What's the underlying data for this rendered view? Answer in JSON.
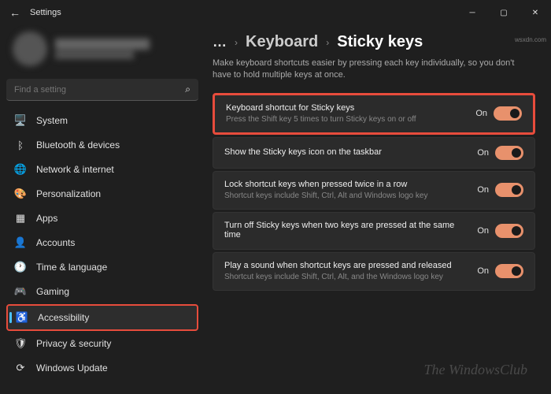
{
  "window": {
    "title": "Settings"
  },
  "search": {
    "placeholder": "Find a setting"
  },
  "sidebar": {
    "items": [
      {
        "label": "System",
        "icon": "🖥️"
      },
      {
        "label": "Bluetooth & devices",
        "icon": "ᛒ"
      },
      {
        "label": "Network & internet",
        "icon": "🌐"
      },
      {
        "label": "Personalization",
        "icon": "🎨"
      },
      {
        "label": "Apps",
        "icon": "▦"
      },
      {
        "label": "Accounts",
        "icon": "👤"
      },
      {
        "label": "Time & language",
        "icon": "🕐"
      },
      {
        "label": "Gaming",
        "icon": "🎮"
      },
      {
        "label": "Accessibility",
        "icon": "♿"
      },
      {
        "label": "Privacy & security",
        "icon": "🛡"
      },
      {
        "label": "Windows Update",
        "icon": "⟳"
      }
    ]
  },
  "breadcrumb": {
    "parent": "Keyboard",
    "current": "Sticky keys"
  },
  "description": "Make keyboard shortcuts easier by pressing each key individually, so you don't have to hold multiple keys at once.",
  "settings": [
    {
      "title": "Keyboard shortcut for Sticky keys",
      "desc": "Press the Shift key 5 times to turn Sticky keys on or off",
      "state": "On"
    },
    {
      "title": "Show the Sticky keys icon on the taskbar",
      "desc": "",
      "state": "On"
    },
    {
      "title": "Lock shortcut keys when pressed twice in a row",
      "desc": "Shortcut keys include Shift, Ctrl, Alt and Windows logo key",
      "state": "On"
    },
    {
      "title": "Turn off Sticky keys when two keys are pressed at the same time",
      "desc": "",
      "state": "On"
    },
    {
      "title": "Play a sound when shortcut keys are pressed and released",
      "desc": "Shortcut keys include Shift, Ctrl, Alt, and the Windows logo key",
      "state": "On"
    }
  ],
  "watermark": "The WindowsClub",
  "wsxdn": "wsxdn.com"
}
